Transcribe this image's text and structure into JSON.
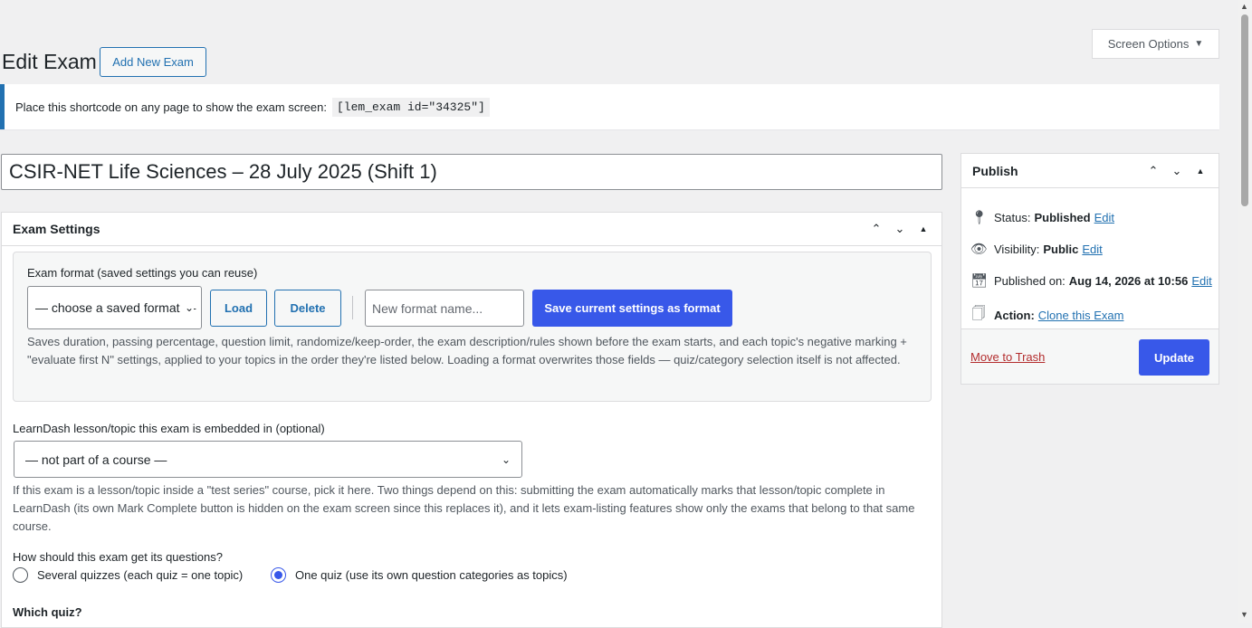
{
  "screen_options": {
    "label": "Screen Options",
    "caret": "▼"
  },
  "header": {
    "title": "Edit Exam",
    "add_new": "Add New Exam"
  },
  "notice": {
    "text": "Place this shortcode on any page to show the exam screen:",
    "shortcode": "[lem_exam id=\"34325\"]"
  },
  "title_input": {
    "value": "CSIR-NET Life Sciences – 28 July 2025 (Shift 1)"
  },
  "exam_settings": {
    "heading": "Exam Settings",
    "format": {
      "label": "Exam format (saved settings you can reuse)",
      "select_value": "— choose a saved format —",
      "load": "Load",
      "delete": "Delete",
      "name_placeholder": "New format name...",
      "save": "Save current settings as format",
      "help": "Saves duration, passing percentage, question limit, randomize/keep-order, the exam description/rules shown before the exam starts, and each topic's negative marking + \"evaluate first N\" settings, applied to your topics in the order they're listed below. Loading a format overwrites those fields — quiz/category selection itself is not affected."
    },
    "learndash": {
      "label": "LearnDash lesson/topic this exam is embedded in (optional)",
      "select_value": "— not part of a course —",
      "help": "If this exam is a lesson/topic inside a \"test series\" course, pick it here. Two things depend on this: submitting the exam automatically marks that lesson/topic complete in LearnDash (its own Mark Complete button is hidden on the exam screen since this replaces it), and it lets exam-listing features show only the exams that belong to that same course."
    },
    "questions": {
      "label": "How should this exam get its questions?",
      "option_several": "Several quizzes (each quiz = one topic)",
      "option_one": "One quiz (use its own question categories as topics)",
      "selected": "one"
    },
    "which_quiz": "Which quiz?"
  },
  "publish": {
    "heading": "Publish",
    "status_label": "Status:",
    "status_value": "Published",
    "status_edit": "Edit",
    "visibility_label": "Visibility:",
    "visibility_value": "Public",
    "visibility_edit": "Edit",
    "published_label": "Published on:",
    "published_value": "Aug 14, 2026 at 10:56",
    "published_edit": "Edit",
    "action_label": "Action:",
    "action_link": "Clone this Exam",
    "trash": "Move to Trash",
    "update": "Update"
  }
}
